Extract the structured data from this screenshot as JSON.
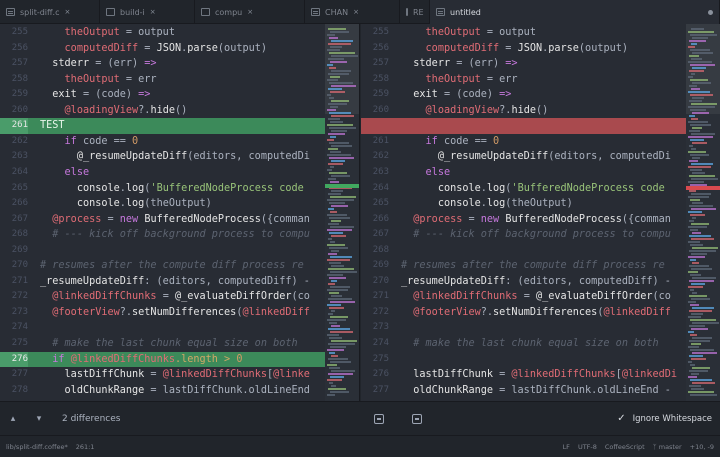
{
  "tabs": [
    {
      "label": "split-diff.c",
      "icon": "file-icon",
      "active": false
    },
    {
      "label": "build-i",
      "icon": "image-file-icon",
      "active": false
    },
    {
      "label": "compu",
      "icon": "image-file-icon",
      "active": false
    },
    {
      "label": "CHAN",
      "icon": "file-icon",
      "active": false
    },
    {
      "label": "RE",
      "icon": "file-icon",
      "active": false
    },
    {
      "label": "untitled",
      "icon": "file-icon",
      "active": true
    }
  ],
  "left_lines": [
    {
      "n": "255",
      "html": "    <span class=\"v\">theOutput</span> = output",
      "type": ""
    },
    {
      "n": "256",
      "html": "    <span class=\"v\">computedDiff</span> = <span class=\"w\">JSON</span>.<span class=\"w\">parse</span>(output)",
      "type": ""
    },
    {
      "n": "257",
      "html": "  <span class=\"w\">stderr</span> = (err) <span class=\"k\">=&gt;</span>",
      "type": ""
    },
    {
      "n": "258",
      "html": "    <span class=\"v\">theOutput</span> = err",
      "type": ""
    },
    {
      "n": "259",
      "html": "  <span class=\"w\">exit</span> = (code) <span class=\"k\">=&gt;</span>",
      "type": ""
    },
    {
      "n": "260",
      "html": "    <span class=\"v\">@loadingView</span>?.<span class=\"w\">hide</span>()",
      "type": ""
    },
    {
      "n": "261",
      "html": "TEST",
      "type": "added"
    },
    {
      "n": "262",
      "html": "    <span class=\"k\">if</span> code == <span class=\"n\">0</span>",
      "type": ""
    },
    {
      "n": "263",
      "html": "      <span class=\"w\">@_resumeUpdateDiff</span>(editors, computedDi",
      "type": ""
    },
    {
      "n": "264",
      "html": "    <span class=\"k\">else</span>",
      "type": ""
    },
    {
      "n": "265",
      "html": "      <span class=\"w\">console</span>.<span class=\"w\">log</span>(<span class=\"s\">'BufferedNodeProcess code</span>",
      "type": ""
    },
    {
      "n": "266",
      "html": "      <span class=\"w\">console</span>.<span class=\"w\">log</span>(theOutput)",
      "type": ""
    },
    {
      "n": "267",
      "html": "  <span class=\"v\">@process</span> = <span class=\"k\">new</span> <span class=\"w\">BufferedNodeProcess</span>({comman",
      "type": ""
    },
    {
      "n": "268",
      "html": "  <span class=\"c\"># --- kick off background process to compu</span>",
      "type": ""
    },
    {
      "n": "269",
      "html": "",
      "type": ""
    },
    {
      "n": "270",
      "html": "<span class=\"c\"># resumes after the compute diff process re</span>",
      "type": ""
    },
    {
      "n": "271",
      "html": "<span class=\"w\">_resumeUpdateDiff</span>: (editors, computedDiff) -",
      "type": ""
    },
    {
      "n": "272",
      "html": "  <span class=\"v\">@linkedDiffChunks</span> = <span class=\"w\">@_evaluateDiffOrder</span>(co",
      "type": ""
    },
    {
      "n": "273",
      "html": "  <span class=\"v\">@footerView</span>?.<span class=\"w\">setNumDifferences</span>(<span class=\"v\">@linkedDiff</span>",
      "type": ""
    },
    {
      "n": "274",
      "html": "",
      "type": ""
    },
    {
      "n": "275",
      "html": "  <span class=\"c\"># make the last chunk equal size on both</span>",
      "type": ""
    },
    {
      "n": "276",
      "html": "  <span class=\"k\">if</span> <span class=\"v\">@linkedDiffChunks</span>.length &gt; <span class=\"n\">0</span>",
      "type": "chunkhi"
    },
    {
      "n": "277",
      "html": "    <span class=\"w\">lastDiffChunk</span> = <span class=\"v\">@linkedDiffChunks</span>[<span class=\"v\">@linke</span>",
      "type": ""
    },
    {
      "n": "278",
      "html": "    <span class=\"w\">oldChunkRange</span> = lastDiffChunk.oldLineEnd",
      "type": ""
    }
  ],
  "right_lines": [
    {
      "n": "255",
      "html": "    <span class=\"v\">theOutput</span> = output",
      "type": ""
    },
    {
      "n": "256",
      "html": "    <span class=\"v\">computedDiff</span> = <span class=\"w\">JSON</span>.<span class=\"w\">parse</span>(output)",
      "type": ""
    },
    {
      "n": "257",
      "html": "  <span class=\"w\">stderr</span> = (err) <span class=\"k\">=&gt;</span>",
      "type": ""
    },
    {
      "n": "258",
      "html": "    <span class=\"v\">theOutput</span> = err",
      "type": ""
    },
    {
      "n": "259",
      "html": "  <span class=\"w\">exit</span> = (code) <span class=\"k\">=&gt;</span>",
      "type": ""
    },
    {
      "n": "260",
      "html": "    <span class=\"v\">@loadingView</span>?.<span class=\"w\">hide</span>()",
      "type": ""
    },
    {
      "n": "",
      "html": "",
      "type": "removed"
    },
    {
      "n": "261",
      "html": "    <span class=\"k\">if</span> code == <span class=\"n\">0</span>",
      "type": ""
    },
    {
      "n": "262",
      "html": "      <span class=\"w\">@_resumeUpdateDiff</span>(editors, computedDi",
      "type": ""
    },
    {
      "n": "263",
      "html": "    <span class=\"k\">else</span>",
      "type": ""
    },
    {
      "n": "264",
      "html": "      <span class=\"w\">console</span>.<span class=\"w\">log</span>(<span class=\"s\">'BufferedNodeProcess code</span>",
      "type": ""
    },
    {
      "n": "265",
      "html": "      <span class=\"w\">console</span>.<span class=\"w\">log</span>(theOutput)",
      "type": ""
    },
    {
      "n": "266",
      "html": "  <span class=\"v\">@process</span> = <span class=\"k\">new</span> <span class=\"w\">BufferedNodeProcess</span>({comman",
      "type": ""
    },
    {
      "n": "267",
      "html": "  <span class=\"c\"># --- kick off background process to compu</span>",
      "type": ""
    },
    {
      "n": "268",
      "html": "",
      "type": ""
    },
    {
      "n": "269",
      "html": "<span class=\"c\"># resumes after the compute diff process re</span>",
      "type": ""
    },
    {
      "n": "270",
      "html": "<span class=\"w\">_resumeUpdateDiff</span>: (editors, computedDiff) -",
      "type": ""
    },
    {
      "n": "271",
      "html": "  <span class=\"v\">@linkedDiffChunks</span> = <span class=\"w\">@_evaluateDiffOrder</span>(co",
      "type": ""
    },
    {
      "n": "272",
      "html": "  <span class=\"v\">@footerView</span>?.<span class=\"w\">setNumDifferences</span>(<span class=\"v\">@linkedDiff</span>",
      "type": ""
    },
    {
      "n": "273",
      "html": "",
      "type": ""
    },
    {
      "n": "274",
      "html": "  <span class=\"c\"># make the last chunk equal size on both</span>",
      "type": ""
    },
    {
      "n": "275",
      "html": "",
      "type": "blank"
    },
    {
      "n": "276",
      "html": "  <span class=\"w\">lastDiffChunk</span> = <span class=\"v\">@linkedDiffChunks</span>[<span class=\"v\">@linkedDi</span>",
      "type": ""
    },
    {
      "n": "277",
      "html": "  <span class=\"w\">oldChunkRange</span> = lastDiffChunk.oldLineEnd -",
      "type": ""
    }
  ],
  "diff_panel": {
    "prev_icon": "chevron-up-icon",
    "next_icon": "chevron-down-icon",
    "count": "2 differences",
    "ignore_whitespace": "Ignore Whitespace"
  },
  "status": {
    "left": [
      "lib/split-diff.coffee*",
      "261:1"
    ],
    "right": [
      "LF",
      "UTF-8",
      "CoffeeScript",
      "master",
      "+10, -9"
    ]
  }
}
